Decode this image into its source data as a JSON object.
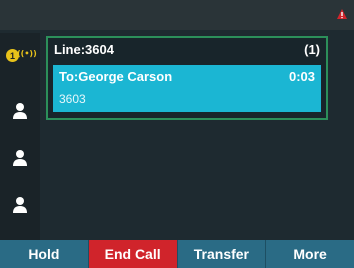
{
  "line": {
    "label": "Line:3604",
    "count": "(1)"
  },
  "call": {
    "to": "To:George Carson",
    "timer": "0:03",
    "number": "3603"
  },
  "line_key_badge": "1",
  "softkeys": {
    "hold": "Hold",
    "end_call": "End Call",
    "transfer": "Transfer",
    "more": "More"
  },
  "colors": {
    "active_call": "#1bb6d3",
    "end_call": "#d0242b",
    "softkey_bar": "#2a6b85",
    "badge": "#e8c21a",
    "panel_border": "#2c8f5a"
  }
}
